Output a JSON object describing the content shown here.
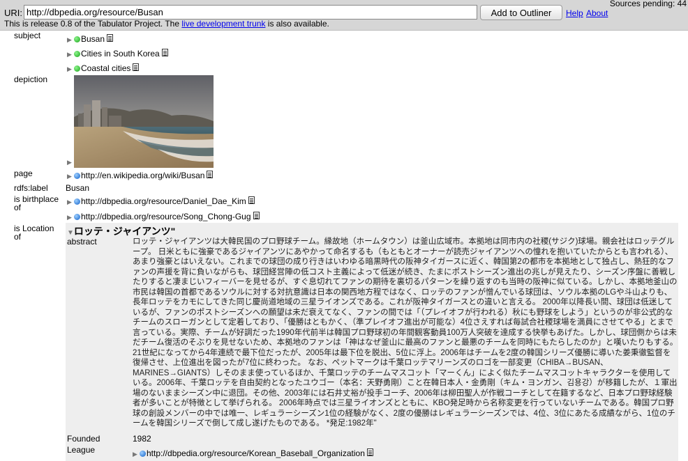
{
  "toolbar": {
    "uri_label": "URI:",
    "uri_value": "http://dbpedia.org/resource/Busan",
    "add_button": "Add to Outliner",
    "help_link": "Help",
    "about_link": "About",
    "sources_pending": "Sources pending: 44",
    "release_prefix": "This is release 0.8 of the Tabulator Project. The ",
    "release_link": "live development trunk",
    "release_suffix": " is also available."
  },
  "rows": {
    "subject": {
      "label": "subject",
      "items": [
        "Busan",
        "Cities in South Korea",
        "Coastal cities"
      ]
    },
    "depiction": {
      "label": "depiction"
    },
    "page": {
      "label": "page",
      "value": "http://en.wikipedia.org/wiki/Busan"
    },
    "rdfs_label": {
      "label": "rdfs:label",
      "value": "Busan"
    },
    "birthplace": {
      "label1": "is birthplace",
      "label2": "of",
      "items": [
        "http://dbpedia.org/resource/Daniel_Dae_Kim",
        "http://dbpedia.org/resource/Song_Chong-Gug"
      ]
    },
    "location": {
      "label1": "is Location",
      "label2": "of",
      "title": "ロッテ・ジャイアンツ\"",
      "abstract_label": "abstract",
      "abstract": "ロッテ・ジャイアンツは大韓民国のプロ野球チーム。縁故地（ホームタウン）は釜山広域市。本拠地は同市内の社稷(サジク)球場。親会社はロッテグループ。 日米ともに強豪であるジャイアンツにあやかって命名するも（もともとオーナーが読売ジャイアンツへの憧れを抱いていたからとも言われる）、あまり強豪とはいえない。これまでの球団の成り行きはいわゆる暗黒時代の阪神タイガースに近く、韓国第2の都市を本拠地として独占し、熱狂的なファンの声援を背に負いながらも、球団経営陣の低コスト主義によって低迷が続き、たまにポストシーズン進出の兆しが見えたり、シーズン序盤に善戦したりすると凄まじいフィーバーを見せるが、すぐ息切れてファンの期待を裏切るパターンを繰り返すのも当時の阪神に似ている。しかし、本拠地釜山の市民は韓国の首都であるソウルに対する対抗意識は日本の関西地方程ではなく、ロッテのファンが憎んでいる球団は、ソウル本拠のLGや斗山よりも、長年ロッテをカモにしてきた同じ慶尚道地域の三星ライオンズである。これが阪神タイガースとの違いと言える。 2000年以降長い間、球団は低迷しているが、ファンのポストシーズンへの願望は未だ衰えてなく、ファンの間では「（プレイオフが行われる）秋にも野球をしよう」というのが非公式的なチームのスローガンとして定着しており、「優勝はともかく、（準プレイオフ進出が可能な）4位さえすれば毎試合社稷球場を満員にさせてやる」とまで言っている。実際、チームが好調だった1990年代前半は韓国プロ野球初の年間観客動員100万人突破を達成する快挙もあげた。しかし、球団側からは未だチーム復活のそぶりを見せないため、本拠地のファンは「神はなぜ釜山に最高のファンと最悪のチームを同時にもたらしたのか」と嘆いたりもする。 21世紀になってから4年連続で最下位だったが、2005年は最下位を脱出、5位に浮上。2006年はチームを2度の韓国シリーズ優勝に導いた姜秉徹監督を復帰させ、上位進出を図ったが7位に終わった。 なお、ペットマークは千葉ロッテマリーンズのロゴを一部変更（CHIBA→BUSAN、MARINES→GIANTS）しそのまま使っているほか、千葉ロッテのチームマスコット「マーくん」によく似たチームマスコットキャラクターを使用している。2006年、千葉ロッテを自由契約となったユウゴー（本名：天野勇剛）こと在韓日本人・金勇剛（キム・ヨンガン、김용강）が移籍したが、１軍出場のないままシーズン中に退団。その他、2003年には石井丈裕が投手コーチ、2006年は柳田聖人が作戦コーチとして在籍するなど、日本プロ野球経験者が多いことが特徴として挙げられる。 2006年時点では三星ライオンズとともに、KBO発足時から名称変更を行っていないチームである。韓国プロ野球の創設メンバーの中では唯一、レギュラーシーズン1位の経験がなく、2度の優勝はレギュラーシーズンでは、4位、3位にあたる成績ながら、1位のチームを韓国シリーズで倒して成し遂げたものである。 *発足:1982年\"",
      "founded_label": "Founded",
      "founded_value": "1982",
      "league_label": "League",
      "league_value": "http://dbpedia.org/resource/Korean_Baseball_Organization"
    }
  },
  "colors": {
    "link": "#0000ee",
    "topbar": "#d6d6d6",
    "panel": "#eeeeee"
  }
}
